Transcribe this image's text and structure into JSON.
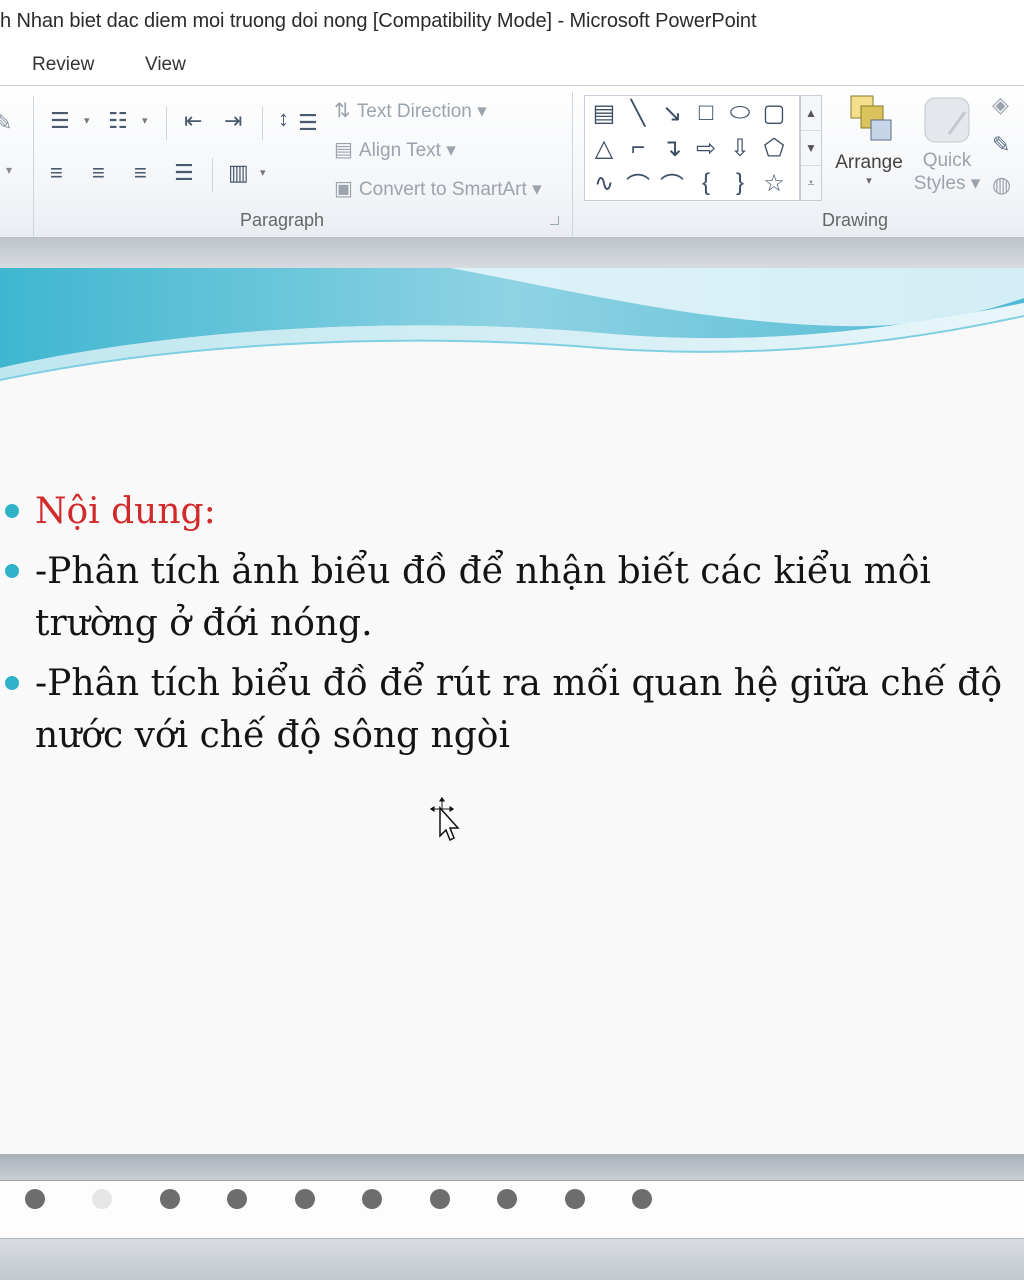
{
  "window": {
    "title": "h Nhan biet dac diem moi truong doi nong [Compatibility Mode]  -  Microsoft PowerPoint"
  },
  "tabs": [
    {
      "label": "Review"
    },
    {
      "label": "View"
    }
  ],
  "ribbon": {
    "paragraph": {
      "text_direction": "Text Direction",
      "align_text": "Align Text",
      "convert_smartart": "Convert to SmartArt",
      "group_label": "Paragraph"
    },
    "drawing": {
      "arrange": "Arrange",
      "quick_styles_line1": "Quick",
      "quick_styles_line2": "Styles",
      "group_label": "Drawing"
    },
    "icons": [
      "bullets-icon",
      "numbering-icon",
      "decrease-indent-icon",
      "increase-indent-icon",
      "line-spacing-icon",
      "align-left-icon",
      "center-icon",
      "align-right-icon",
      "justify-icon",
      "columns-icon",
      "shape-fill-icon",
      "shape-outline-icon",
      "shape-effects-icon"
    ]
  },
  "shapes_gallery": [
    "text-box",
    "line",
    "arrow-line",
    "rectangle",
    "oval",
    "rounded-rectangle",
    "triangle",
    "elbow-connector",
    "elbow-arrow-connector",
    "right-arrow",
    "down-arrow",
    "pentagon-shape",
    "freeform",
    "arc",
    "curve",
    "left-brace",
    "right-brace",
    "star"
  ],
  "slide": {
    "accent_color": "#2eb3c9",
    "bullets": [
      {
        "lines": [
          "Nội dung:"
        ],
        "color": "#d12a2a"
      },
      {
        "lines": [
          "-Phân tích ảnh biểu đồ để nhận biết các kiểu môi",
          "trường ở đới nóng."
        ],
        "color": "#141414"
      },
      {
        "lines": [
          "-Phân tích biểu đồ để rút ra mối quan hệ giữa chế độ",
          "nước với chế độ sông ngòi"
        ],
        "color": "#141414"
      }
    ]
  }
}
